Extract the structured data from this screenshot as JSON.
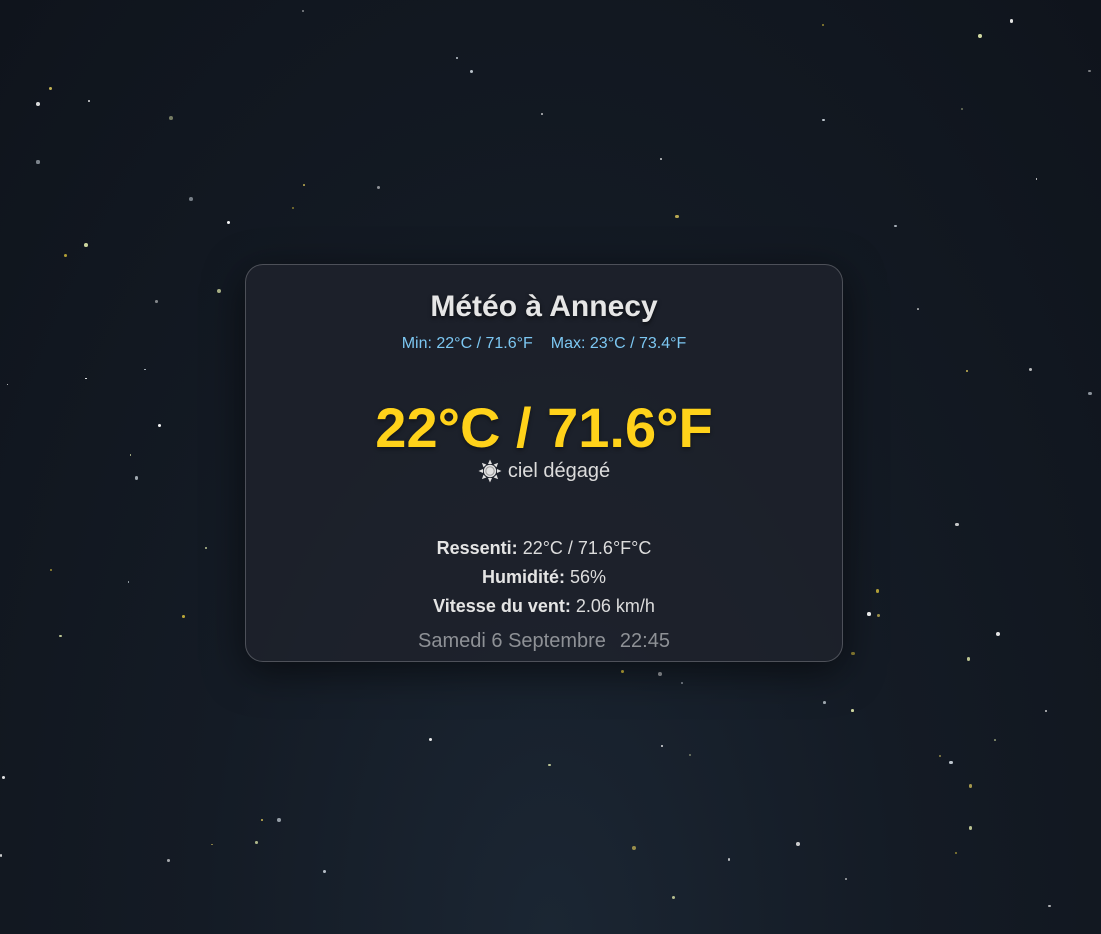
{
  "weather": {
    "title": "Météo à Annecy",
    "min_label": "Min: 22°C / 71.6°F",
    "max_label": "Max: 23°C / 73.4°F",
    "temperature": "22°C / 71.6°F",
    "condition_icon": "sun-icon",
    "condition": "ciel dégagé",
    "details": {
      "feels_like_label": "Ressenti:",
      "feels_like_value": "22°C / 71.6°F°C",
      "humidity_label": "Humidité:",
      "humidity_value": "56%",
      "wind_label": "Vitesse du vent:",
      "wind_value": "2.06 km/h"
    },
    "date": "Samedi 6 Septembre",
    "time": "22:45"
  },
  "colors": {
    "temperature": "#ffd21a",
    "minmax": "#7cc7f2",
    "background": "#141b25"
  }
}
